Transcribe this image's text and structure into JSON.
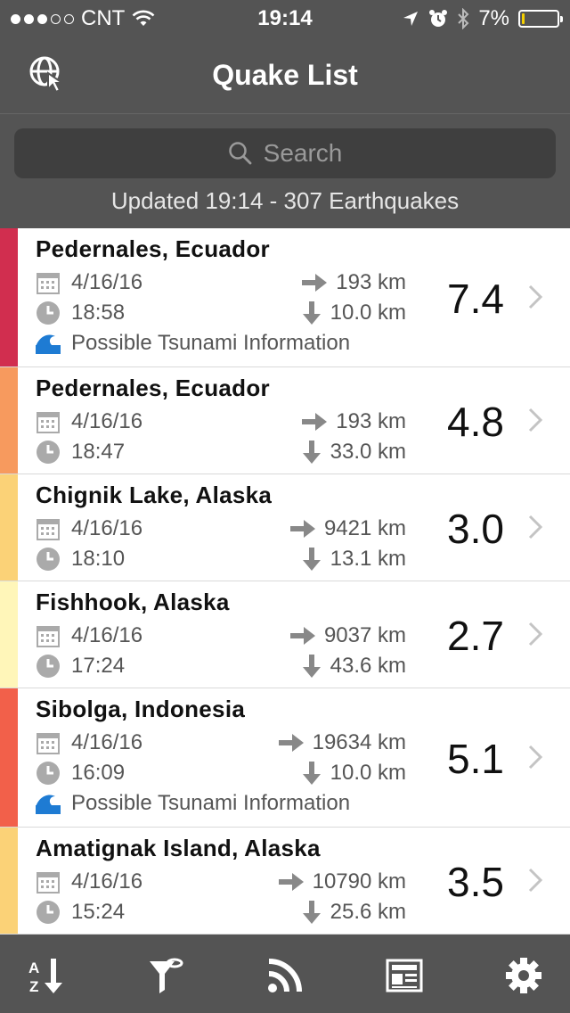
{
  "status": {
    "carrier": "CNT",
    "time": "19:14",
    "battery_pct": "7%",
    "battery_level": 0.07,
    "signal_bars_filled": 3,
    "signal_bars_total": 5
  },
  "nav": {
    "title": "Quake List",
    "left_icon": "globe-cursor-icon"
  },
  "search": {
    "placeholder": "Search"
  },
  "updated_text": "Updated 19:14 - 307 Earthquakes",
  "colors": {
    "header_bg": "#545454",
    "search_bg": "#3f3f3f",
    "tsunami_icon": "#1e7bd3"
  },
  "quakes": [
    {
      "place": "Pedernales, Ecuador",
      "date": "4/16/16",
      "time": "18:58",
      "distance": "193 km",
      "depth": "10.0 km",
      "magnitude": "7.4",
      "tsunami": "Possible Tsunami Information",
      "stripe": "#d12e4f"
    },
    {
      "place": "Pedernales, Ecuador",
      "date": "4/16/16",
      "time": "18:47",
      "distance": "193 km",
      "depth": "33.0 km",
      "magnitude": "4.8",
      "tsunami": "",
      "stripe": "#f79a5e"
    },
    {
      "place": "Chignik Lake, Alaska",
      "date": "4/16/16",
      "time": "18:10",
      "distance": "9421 km",
      "depth": "13.1 km",
      "magnitude": "3.0",
      "tsunami": "",
      "stripe": "#fbd277"
    },
    {
      "place": "Fishhook, Alaska",
      "date": "4/16/16",
      "time": "17:24",
      "distance": "9037 km",
      "depth": "43.6 km",
      "magnitude": "2.7",
      "tsunami": "",
      "stripe": "#fff6b9"
    },
    {
      "place": "Sibolga, Indonesia",
      "date": "4/16/16",
      "time": "16:09",
      "distance": "19634 km",
      "depth": "10.0 km",
      "magnitude": "5.1",
      "tsunami": "Possible Tsunami Information",
      "stripe": "#f2604a"
    },
    {
      "place": "Amatignak Island, Alaska",
      "date": "4/16/16",
      "time": "15:24",
      "distance": "10790 km",
      "depth": "25.6 km",
      "magnitude": "3.5",
      "tsunami": "",
      "stripe": "#fbd277"
    }
  ],
  "tabs": [
    {
      "name": "sort-az-icon"
    },
    {
      "name": "filter-icon"
    },
    {
      "name": "rss-feed-icon"
    },
    {
      "name": "news-icon"
    },
    {
      "name": "settings-gear-icon"
    }
  ]
}
